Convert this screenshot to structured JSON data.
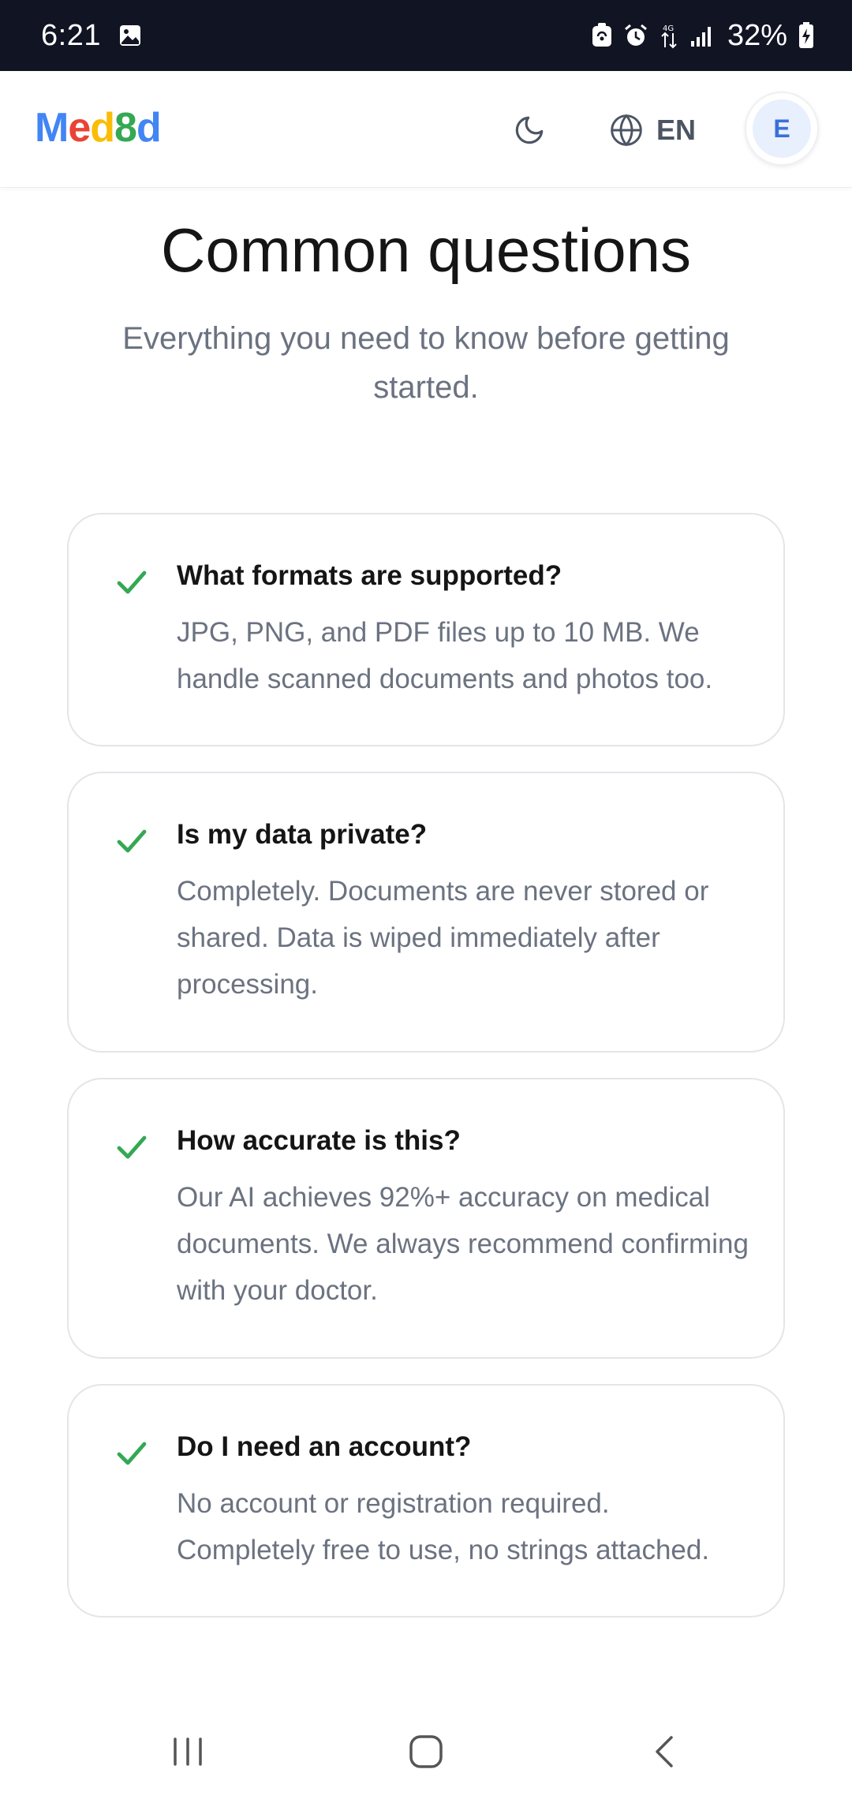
{
  "status_bar": {
    "time": "6:21",
    "battery": "32%",
    "icons": [
      "gallery-icon",
      "nfc-icon",
      "alarm-icon",
      "data-arrows-icon",
      "signal-icon",
      "battery-charging-icon"
    ]
  },
  "header": {
    "logo": {
      "letters": [
        "M",
        "e",
        "d",
        "8",
        "d"
      ],
      "colors": [
        "#4285F4",
        "#EA4335",
        "#FBBC05",
        "#34A853",
        "#4285F4"
      ]
    },
    "theme_icon": "moon-icon",
    "language_icon": "globe-icon",
    "language": "EN",
    "avatar_initial": "E"
  },
  "main": {
    "title": "Common questions",
    "subtitle": "Everything you need to know before getting started.",
    "check_color": "#34A853",
    "faqs": [
      {
        "question": "What formats are supported?",
        "answer": "JPG, PNG, and PDF files up to 10 MB. We handle scanned documents and photos too."
      },
      {
        "question": "Is my data private?",
        "answer": "Completely. Documents are never stored or shared. Data is wiped immediately after processing."
      },
      {
        "question": "How accurate is this?",
        "answer": "Our AI achieves 92%+ accuracy on medical documents. We always recommend confirming with your doctor."
      },
      {
        "question": "Do I need an account?",
        "answer": "No account or registration required. Completely free to use, no strings attached."
      }
    ]
  },
  "nav_bar": {
    "icons": [
      "recent-apps-icon",
      "home-icon",
      "back-icon"
    ]
  }
}
